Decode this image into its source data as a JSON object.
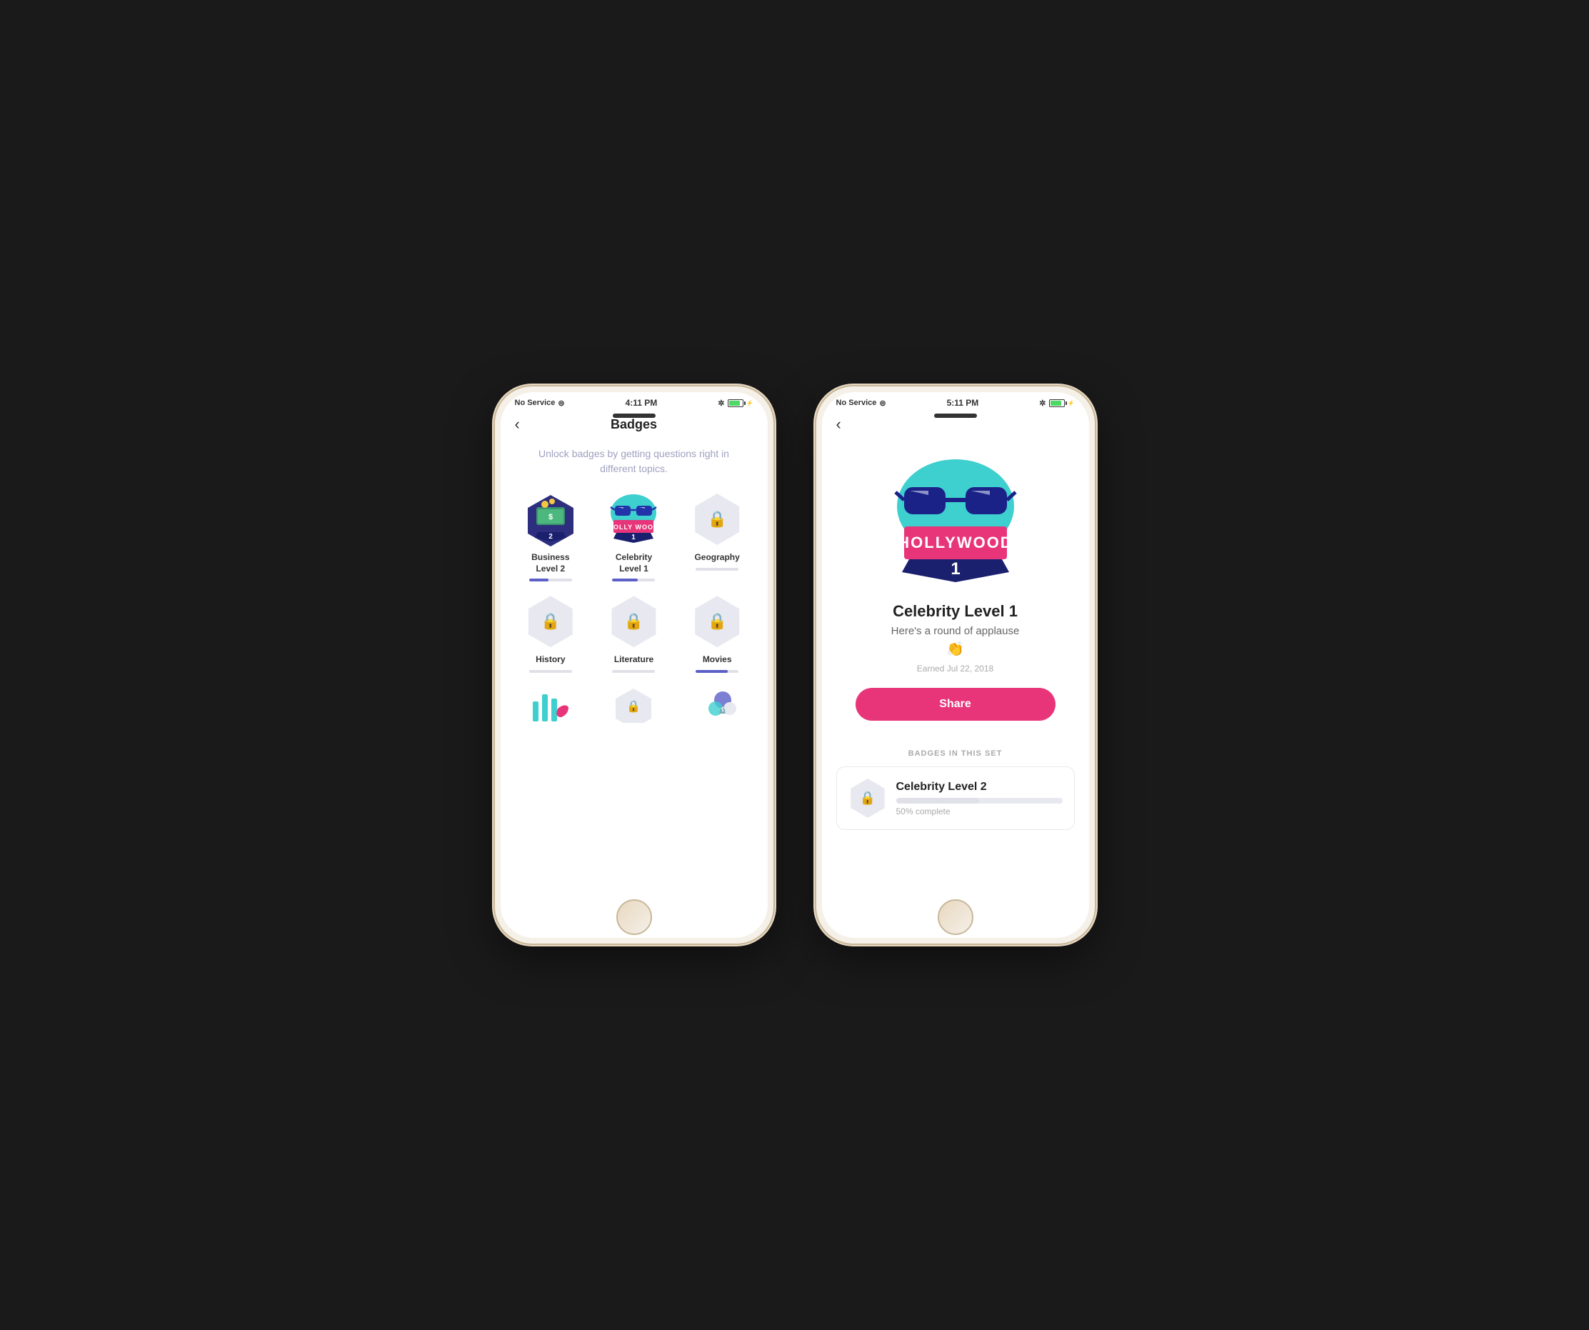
{
  "phone1": {
    "status": {
      "left": "No Service",
      "time": "4:11 PM",
      "right_symbol": "✲"
    },
    "nav": {
      "back_label": "‹",
      "title": "Badges"
    },
    "subtitle": "Unlock badges by getting questions right in different topics.",
    "badges": [
      {
        "id": "business",
        "name": "Business Level 2",
        "level": "2",
        "unlocked": true,
        "progress": 45,
        "progress_color": "#5b5fc7"
      },
      {
        "id": "celebrity",
        "name": "Celebrity Level 1",
        "level": "1",
        "unlocked": true,
        "progress": 60,
        "progress_color": "#5b5fc7"
      },
      {
        "id": "geography",
        "name": "Geography",
        "unlocked": false,
        "progress": 0,
        "progress_color": "#e0e0e8"
      },
      {
        "id": "history",
        "name": "History",
        "unlocked": false,
        "progress": 0,
        "progress_color": "#e0e0e8"
      },
      {
        "id": "literature",
        "name": "Literature",
        "unlocked": false,
        "progress": 0,
        "progress_color": "#e0e0e8"
      },
      {
        "id": "movies",
        "name": "Movies",
        "unlocked": false,
        "progress": 80,
        "progress_color": "#5b5fc7"
      }
    ]
  },
  "phone2": {
    "status": {
      "left": "No Service",
      "time": "5:11 PM",
      "right_symbol": "✲"
    },
    "nav": {
      "back_label": "‹"
    },
    "badge_detail": {
      "title": "Celebrity Level 1",
      "subtitle": "Here's a round of applause",
      "emoji": "👏",
      "date": "Earned Jul 22, 2018",
      "share_label": "Share"
    },
    "badges_in_set": {
      "section_label": "BADGES IN THIS SET",
      "next_badge": {
        "name": "Celebrity Level 2",
        "progress_label": "50% complete",
        "progress_pct": 50
      }
    }
  }
}
